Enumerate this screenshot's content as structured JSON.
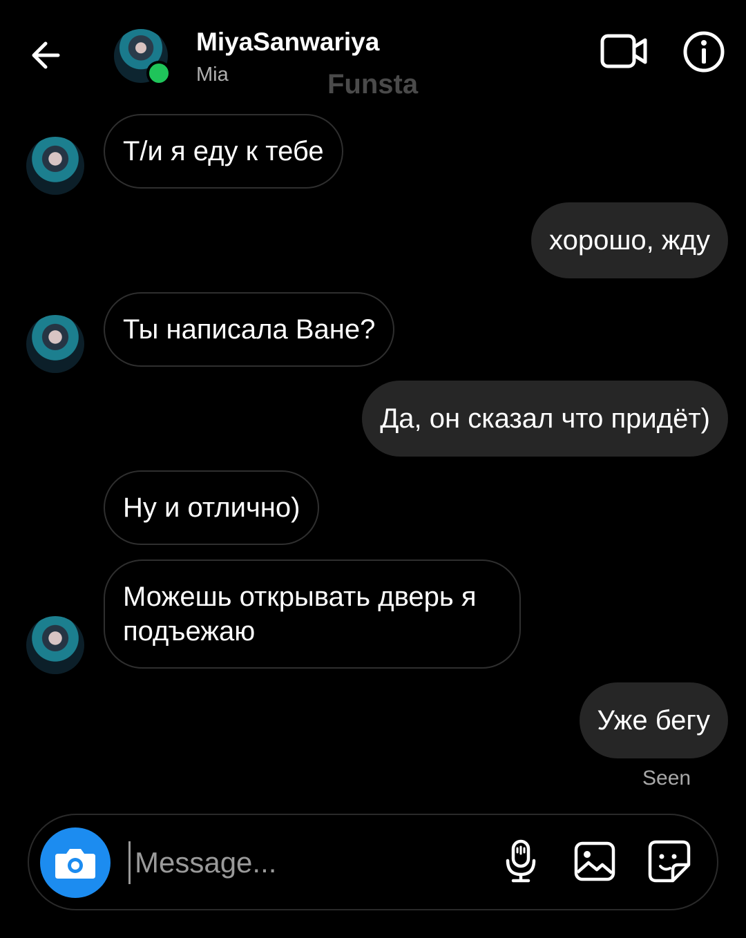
{
  "header": {
    "username": "MiyaSanwariya",
    "display_name": "Mia",
    "watermark": "Funsta",
    "back_icon": "arrow-left-icon",
    "video_icon": "video-camera-icon",
    "info_icon": "info-icon",
    "online_color": "#1fc45a"
  },
  "messages": [
    {
      "direction": "incoming",
      "text": "Т/и я еду к тебе"
    },
    {
      "direction": "outgoing",
      "text": "хорошо, жду"
    },
    {
      "direction": "incoming",
      "text": "Ты написала Ване?"
    },
    {
      "direction": "outgoing",
      "text": "Да, он сказал что придёт)"
    },
    {
      "direction": "incoming",
      "text": "Ну и отлично)"
    },
    {
      "direction": "incoming",
      "text": "Можешь открывать дверь я подъежаю"
    },
    {
      "direction": "outgoing",
      "text": "Уже бегу"
    }
  ],
  "seen_label": "Seen",
  "composer": {
    "placeholder": "Message...",
    "camera_icon": "camera-icon",
    "mic_icon": "microphone-icon",
    "gallery_icon": "image-gallery-icon",
    "sticker_icon": "sticker-icon",
    "camera_color": "#1c8cf0"
  },
  "colors": {
    "background": "#000000",
    "outgoing_bubble": "#262626",
    "incoming_border": "#2f2f2f"
  }
}
